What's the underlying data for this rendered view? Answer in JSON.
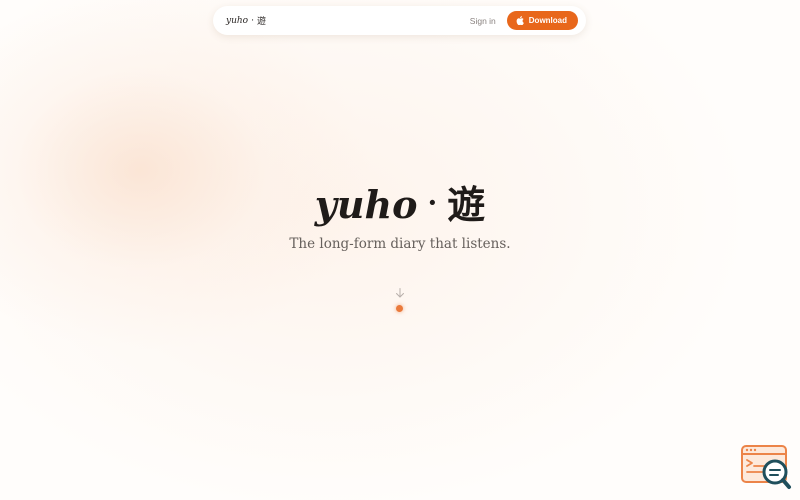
{
  "nav": {
    "brand_latin": "yuho",
    "brand_sep": "·",
    "brand_kanji": "遊",
    "signin_label": "Sign in",
    "download_label": "Download",
    "download_icon": "apple-icon"
  },
  "hero": {
    "title_latin": "yuho",
    "title_sep": "·",
    "title_kanji": "遊",
    "tagline": "The long-form diary that listens.",
    "scroll_icon": "arrow-down-icon"
  },
  "colors": {
    "accent": "#e8671b",
    "background": "#fffdfb",
    "text": "#1f1b19",
    "muted": "#66605c"
  },
  "widget": {
    "icon": "browser-search-icon"
  }
}
